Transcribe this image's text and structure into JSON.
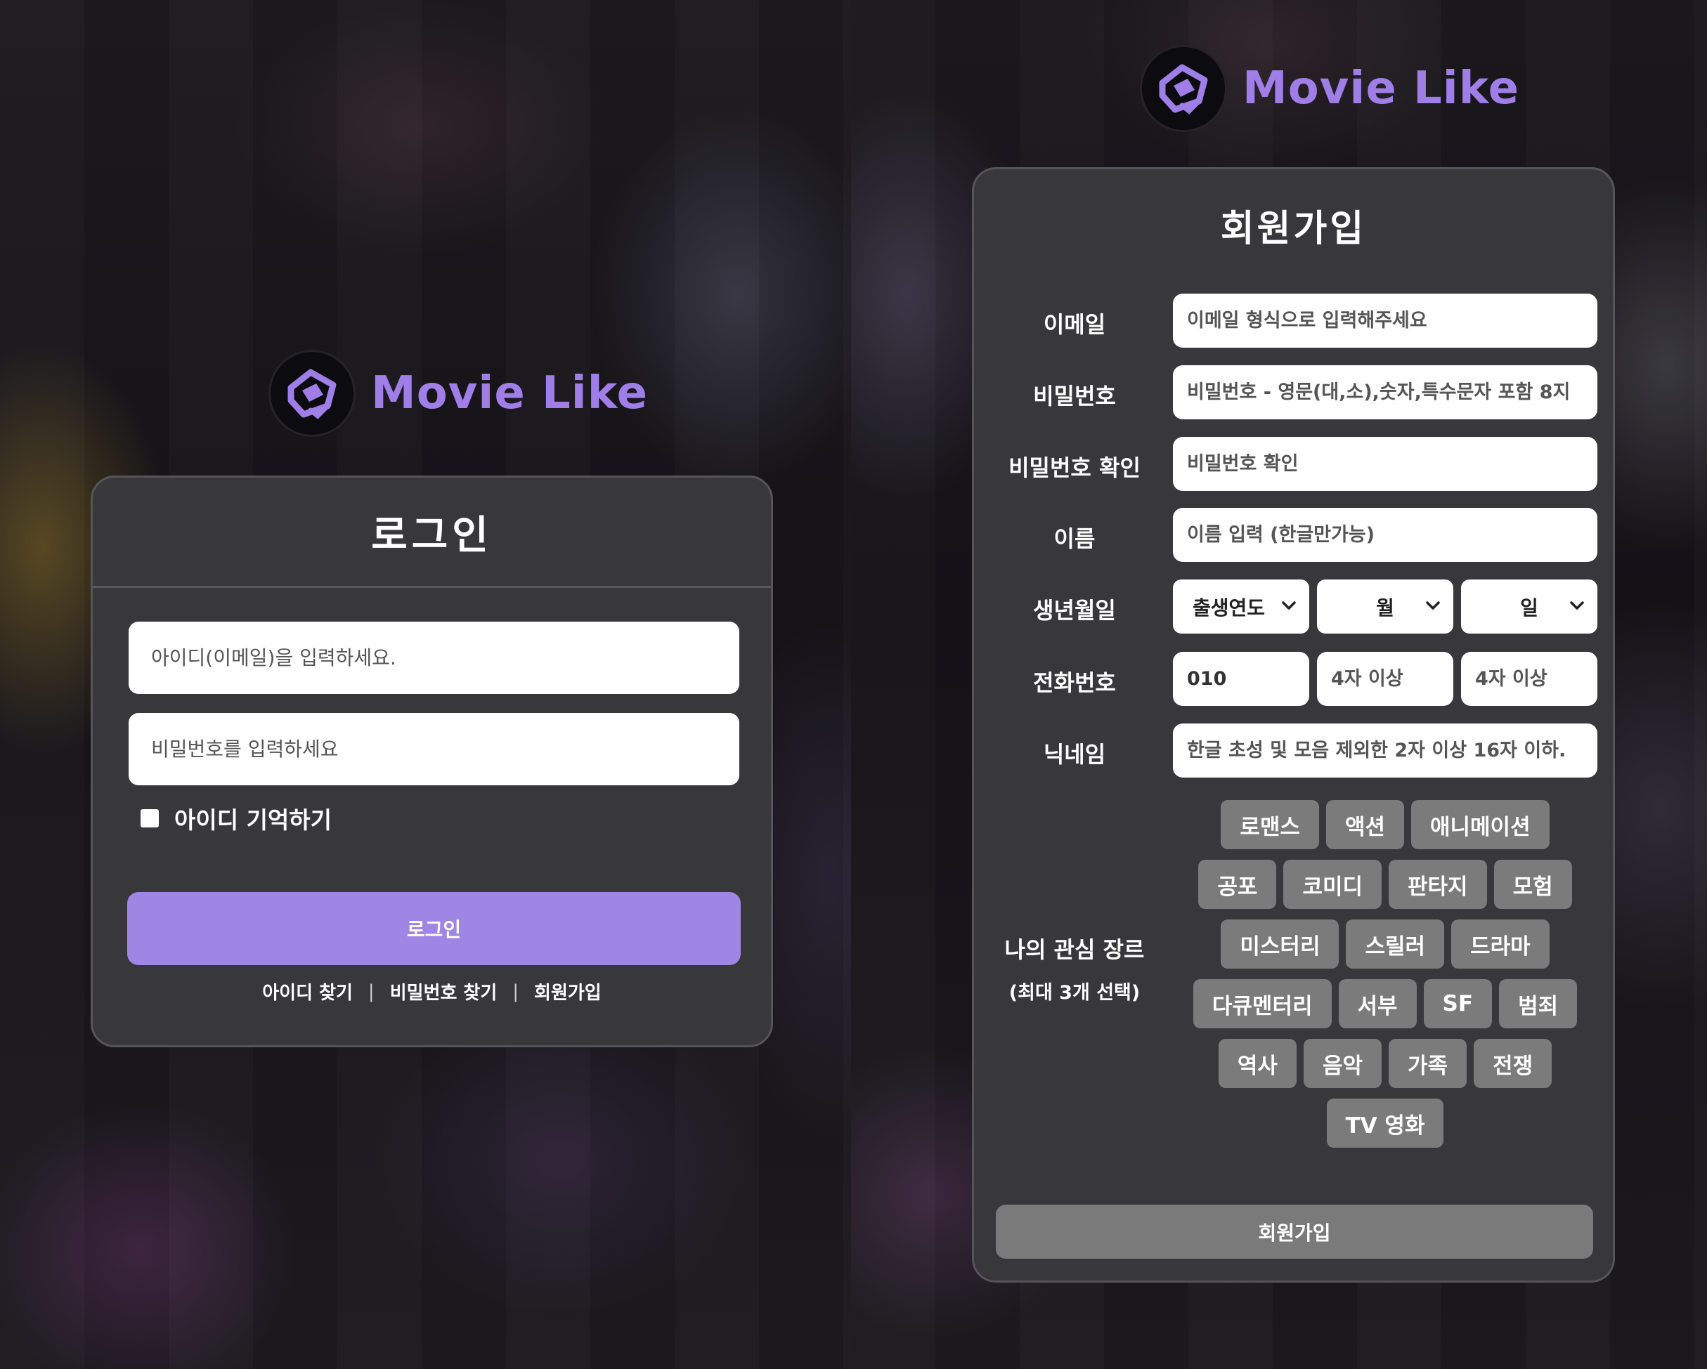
{
  "brand": {
    "name": "Movie Like",
    "accent_color": "#9f7fe7"
  },
  "login": {
    "title": "로그인",
    "id_placeholder": "아이디(이메일)을 입력하세요.",
    "password_placeholder": "비밀번호를 입력하세요",
    "remember_label": "아이디 기억하기",
    "submit_label": "로그인",
    "submit_color": "#9f86e5",
    "links": {
      "find_id": "아이디 찾기",
      "find_password": "비밀번호 찾기",
      "signup": "회원가입",
      "separator": "|"
    }
  },
  "signup": {
    "title": "회원가입",
    "fields": {
      "email": {
        "label": "이메일",
        "placeholder": "이메일 형식으로 입력해주세요"
      },
      "password": {
        "label": "비밀번호",
        "placeholder": "비밀번호 - 영문(대,소),숫자,특수문자 포함 8지"
      },
      "password_confirm": {
        "label": "비밀번호 확인",
        "placeholder": "비밀번호 확인"
      },
      "name": {
        "label": "이름",
        "placeholder": "이름 입력 (한글만가능)"
      },
      "birth": {
        "label": "생년월일",
        "year": "출생연도",
        "month": "월",
        "day": "일"
      },
      "phone": {
        "label": "전화번호",
        "prefix": "010",
        "middle_placeholder": "4자 이상",
        "last_placeholder": "4자 이상"
      },
      "nickname": {
        "label": "닉네임",
        "placeholder": "한글 초성 및 모음 제외한 2자 이상 16자 이하."
      }
    },
    "genres": {
      "label": "나의 관심 장르",
      "sublabel": "(최대 3개 선택)",
      "rows": [
        [
          "로맨스",
          "액션",
          "애니메이션"
        ],
        [
          "공포",
          "코미디",
          "판타지",
          "모험"
        ],
        [
          "미스터리",
          "스릴러",
          "드라마"
        ],
        [
          "다큐멘터리",
          "서부",
          "SF",
          "범죄"
        ],
        [
          "역사",
          "음악",
          "가족",
          "전쟁"
        ],
        [
          "TV 영화"
        ]
      ]
    },
    "submit_label": "회원가입"
  }
}
